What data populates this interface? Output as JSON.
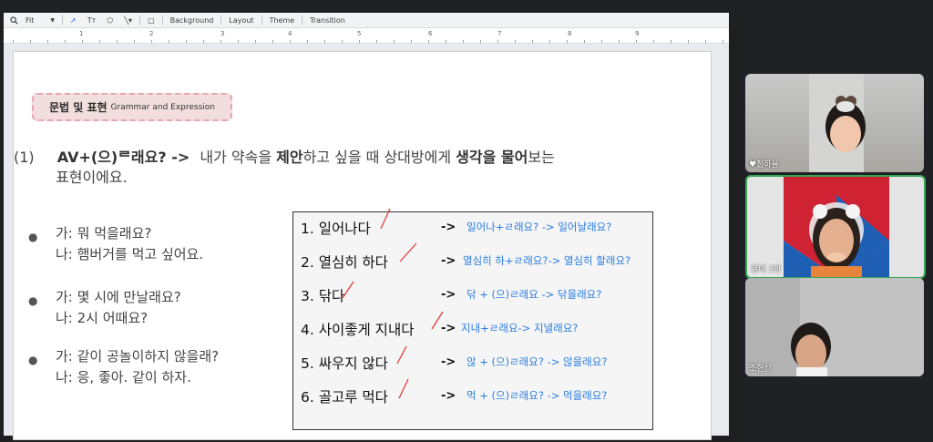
{
  "toolbar": {
    "zoom": "Fit",
    "items": [
      "Background",
      "Layout",
      "Theme",
      "Transition"
    ]
  },
  "ruler": {
    "numbers": [
      "1",
      "2",
      "3",
      "4",
      "5",
      "6",
      "7",
      "8",
      "9"
    ]
  },
  "slide": {
    "badge_korean": "문법 및 표현",
    "badge_english": "Grammar and Expression",
    "point_number": "(1)",
    "point_formula": "AV+(으)ᄅ래요? ->",
    "point_text_a": "내가 약속을",
    "point_bold_a": "제안",
    "point_text_b": "하고 싶을 때 상대방에게",
    "point_bold_b": "생각을 물어",
    "point_text_c": "보는",
    "point_line2": "표현이에요.",
    "examples": [
      {
        "bullet": "●",
        "q": "가: 뭐 먹을래요?",
        "a": "나: 햄버거를 먹고 싶어요."
      },
      {
        "bullet": "●",
        "q": "가: 몇 시에 만날래요?",
        "a": "나: 2시 어때요?"
      },
      {
        "bullet": "●",
        "q": "가: 같이 공놀이하지 않을래?",
        "a": "나: 응, 좋아. 같이 하자."
      }
    ],
    "exercise": [
      {
        "verb": "1. 일어나다",
        "arrow": "->",
        "answer": "일어나+ㄹ래요? -> 일어날래요?"
      },
      {
        "verb": "2. 열심히 하다",
        "arrow": "->",
        "answer": "열심히 하+ㄹ래요?-> 열심히 할래요?"
      },
      {
        "verb": "3. 닦다",
        "arrow": "->",
        "answer": "닦 + (으)ㄹ래요 -> 닦을래요?"
      },
      {
        "verb": "4. 사이좋게 지내다",
        "arrow": "->",
        "answer": "지내+ㄹ래요-> 지낼래요?"
      },
      {
        "verb": "5. 싸우지 않다",
        "arrow": "->",
        "answer": "않 + (으)ㄹ래요? -> 않을래요?"
      },
      {
        "verb": "6. 골고루 먹다",
        "arrow": "->",
        "answer": "먹 + (으)ㄹ래요? -> 먹을래요?"
      }
    ]
  },
  "participants": [
    {
      "name": "♥정하율",
      "active": false
    },
    {
      "name": "열매 3반",
      "active": true
    },
    {
      "name": "조현성",
      "active": false
    }
  ],
  "colors": {
    "accent_answer": "#2a7de1",
    "check_mark": "#e0342f",
    "active_speaker": "#34a853",
    "badge_border": "#e7a6b0"
  }
}
